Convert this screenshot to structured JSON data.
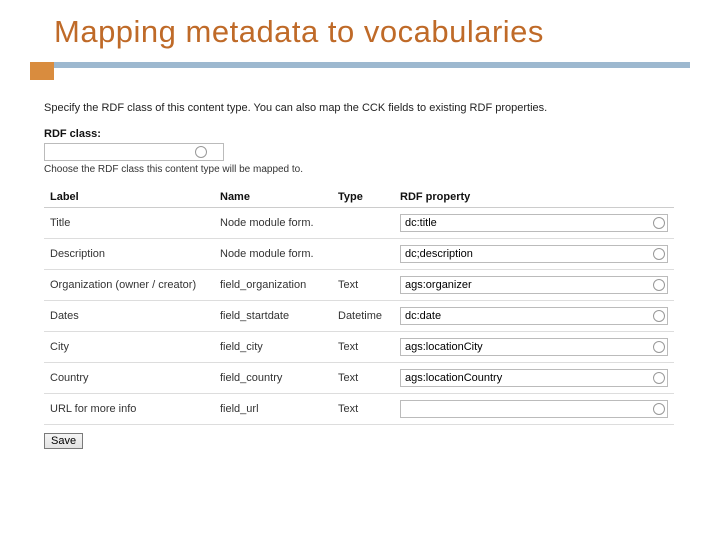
{
  "title": "Mapping metadata to vocabularies",
  "intro": "Specify the RDF class of this content type. You can also map the CCK fields to existing RDF properties.",
  "rdf_class": {
    "label": "RDF class:",
    "value": "",
    "helper": "Choose the RDF class this content type will be mapped to."
  },
  "table": {
    "headers": {
      "label": "Label",
      "name": "Name",
      "type": "Type",
      "prop": "RDF property"
    },
    "rows": [
      {
        "label": "Title",
        "name": "Node module form.",
        "type": "",
        "prop": "dc:title"
      },
      {
        "label": "Description",
        "name": "Node module form.",
        "type": "",
        "prop": "dc;description"
      },
      {
        "label": "Organization (owner / creator)",
        "name": "field_organization",
        "type": "Text",
        "prop": "ags:organizer"
      },
      {
        "label": "Dates",
        "name": "field_startdate",
        "type": "Datetime",
        "prop": "dc:date"
      },
      {
        "label": "City",
        "name": "field_city",
        "type": "Text",
        "prop": "ags:locationCity"
      },
      {
        "label": "Country",
        "name": "field_country",
        "type": "Text",
        "prop": "ags:locationCountry"
      },
      {
        "label": "URL for more info",
        "name": "field_url",
        "type": "Text",
        "prop": ""
      }
    ]
  },
  "save_label": "Save"
}
